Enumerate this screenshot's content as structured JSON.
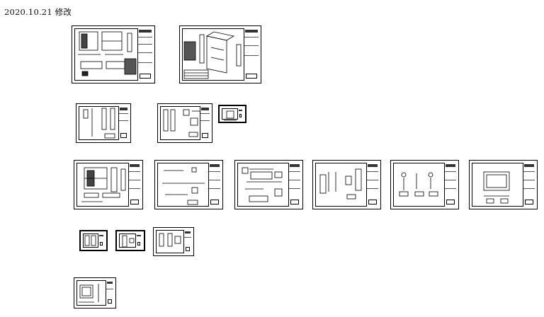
{
  "header": {
    "title": "2020.10.21 修改"
  },
  "sheets": [
    {
      "name": "sheet-plan-elevation-1"
    },
    {
      "name": "sheet-3d-perspective"
    },
    {
      "name": "sheet-detail-a"
    },
    {
      "name": "sheet-detail-b"
    },
    {
      "name": "sheet-detail-c-small"
    },
    {
      "name": "sheet-plan-elevation-2"
    },
    {
      "name": "sheet-section-a"
    },
    {
      "name": "sheet-section-b"
    },
    {
      "name": "sheet-section-c"
    },
    {
      "name": "sheet-section-d"
    },
    {
      "name": "sheet-section-e"
    },
    {
      "name": "sheet-mini-1"
    },
    {
      "name": "sheet-mini-2"
    },
    {
      "name": "sheet-mini-3"
    },
    {
      "name": "sheet-final"
    }
  ]
}
